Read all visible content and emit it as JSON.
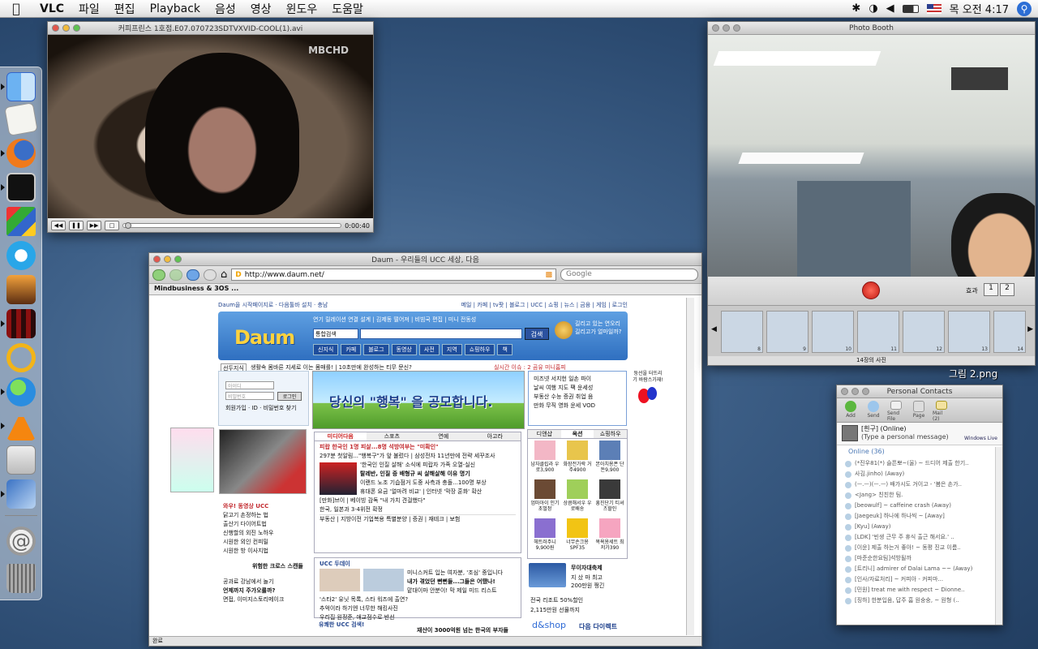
{
  "menubar": {
    "app": "VLC",
    "items": [
      "파일",
      "편집",
      "Playback",
      "음성",
      "영상",
      "윈도우",
      "도움말"
    ],
    "clock": "목 오전 4:17"
  },
  "vlc": {
    "title": "커피프린스 1호점.E07.070723SDTVXVID-COOL(1).avi",
    "broadcaster": "MBCHD",
    "time": "0:00:40"
  },
  "browser": {
    "title": "Daum - 우리들의 UCC 세상, 다음",
    "url": "http://www.daum.net/",
    "search_placeholder": "Google",
    "bookmark": "Mindbusiness & 3OS ...",
    "status": "완료",
    "topline_left": "Daum을 시작페이지로 · 다음툴바 설치 · 충남",
    "topline_links": "메일 | 카페 | tv팟 | 블로그 | UCC | 쇼핑 | 뉴스 | 금융 | 게임 | 로그인",
    "header_hot": "연기  릴레이션 연결 설계 | 김제동 떨어져 | 비빔국 편집 | 미니 전동성",
    "search_scope": "통합검색",
    "search_button": "검색",
    "tabs": [
      "신지식",
      "카페",
      "블로그",
      "동영상",
      "사전",
      "지역",
      "쇼핑하우",
      "책"
    ],
    "promo": "길리고 있는 연오리 길리고가 얼마일까?",
    "ticker": "생활속 몸바른 지세로 이는 몸매를! | 10초만에 완성하는 티무 문신?",
    "ticker_label": "선두지식",
    "realtime": "실시간 이슈 : 2 곰유 미니홈피",
    "banner": "당신의 \"행복\" 을 공모합니다.",
    "login_id": "아이디",
    "login_pw": "비밀번호",
    "login_button": "로그인",
    "login_links": "회원가입 · ID · 비밀번호 찾기",
    "media_tabs": [
      "미디어다음",
      "스포츠",
      "연예",
      "아고라"
    ],
    "news": [
      "피랍 한국인 1명 피살...8명 석방여부는 \"미확인\"",
      "297분 첫알림...\"행복구\"가 앞 불렀다 | 삼성전자 11년만에 전략 세꾸조사",
      "'한국인 인질 살해' 소식에 피랍자 가족 오열-실신",
      "탈레반, 인질 중 배형규 씨 살해살해 이유 명기",
      "이랜드 노조 기습점거 도중 사측과 충돌...100명 부상",
      "휴대폰 요금 '얼마려 비교' | 인터넷 '막장 훈화' 확산",
      "[만화]브이 | 베이빙 감독 \"내 가치 견걸했다\""
    ],
    "news_photo_caption": "한국, 일본과 3·4위전 확정",
    "sports_line": "부동산 | 지방이전 기업복용 특별분양 | 증권 | 재테크 | 보험",
    "ucc_title": "UCC 두데이",
    "ucc_items": [
      "미니스커트 입는 여자분, '조심' 중입니다",
      "내가 겪었던 뻔뻔들...그들은 어땠나!",
      "맡대이마 안분이! 막 제일 미드 리스트",
      "'스타2' 유닛 목록, 스타 워즈에 출연?"
    ],
    "ucc_captions": [
      "추억이라 하기엔 너무한 해킹사진",
      "우리집 원정준, 애교점수로 반선"
    ],
    "ucc_extra": "유쾌한 UCC 검색!",
    "ucc_bottom": "재산이 3000억원 넘는 한국의 부자들",
    "left_ucc_title": "와우! 동영상 UCC",
    "left_ucc_list": [
      "닭고기 손정하는 법",
      "출산기 다이어트법",
      "신행할의 외진 노하우",
      "시원한 외인 컨피밀",
      "시원한 방 이사지법"
    ],
    "left_ad_caption": "위험한 크로스 스캔들",
    "left_ad_lines": [
      "공과료 강남에서 놀기",
      "언제까지 주가오를까?",
      "면접, 이미지스토리메이크"
    ],
    "right_links": [
      "미즈넷 서지헌 일손 파이",
      "날씨 여행 지도 팩 운세성",
      "부동산 수능 증권 취업 음",
      "만화 무직 영화 운세 VOD"
    ],
    "shop_tabs": [
      "디앤샵",
      "옥션",
      "쇼핑하우"
    ],
    "shop_items": [
      "남자클립라 우로3,900",
      "화장전가락 거주4900",
      "본아치용폰 단돈9,900",
      "엄마아이 인기초벌정",
      "상큼해서우 우로배송",
      "흥진단기 티셔츠할인",
      "헤트러주니 9,900원",
      "너무손크용 SPF35",
      "목욕용세트 최저가390"
    ],
    "balloon_text": "둥선을 터뜨리기 바람스가재!",
    "market_title": "무이자대축제",
    "market_lines": [
      "지 샀 마 최고",
      "200만원 쩡긴"
    ],
    "market_list": [
      "전국 리조트 50%할인",
      "2,115만원 선물까지"
    ],
    "dnshop": "d&shop",
    "dnshop_tag": "다음 다이렉트"
  },
  "photobooth": {
    "title": "Photo Booth",
    "effects_label": "효과",
    "shots_label": "14장의 사진",
    "thumb_numbers": [
      "8",
      "9",
      "10",
      "11",
      "12",
      "13",
      "14"
    ]
  },
  "desktop": {
    "file_label": "그림 2.png"
  },
  "contacts": {
    "title": "Personal Contacts",
    "toolbar": [
      "Add",
      "Send",
      "Send File",
      "Page",
      "Mail (2)"
    ],
    "me_name": "[흰구] (Online)",
    "me_status": "(Type a personal message)",
    "brand": "Windows Live",
    "group": "Online (36)",
    "list": [
      "(*진우81(*) 슬픈뽀~(울) ~ 드디어 제출 한기..",
      "사김.jinho) (Away)",
      "(ㅡ.ㅡ)(ㅡ.ㅡ) 배가시도 거이고 - '봄은 손가..",
      "<Jang> 친친한 팀.",
      "[beowulf] ~ caffeine crash (Away)",
      "[Jaegeuk] 하나에 하나씩 ~ [Away]",
      "[Kyu] (Away)",
      "[LDK] '빈생 근무 주 휴식 출근 해서요.' ..",
      "[이운] 제출 하는거 좋아! ~ 동평 진교 이름..",
      "[마준순한요팀]석방될까",
      "[트리니] admirer of Dalai Lama ~~ (Away)",
      "[인사/자료처리] ~ 커피아 - 커피마...",
      "[민원] treat me with respect ~ Dionne..",
      "[징하] 한분입음, 답주 흠 원숭숭, ~ 원형 (.."
    ]
  }
}
